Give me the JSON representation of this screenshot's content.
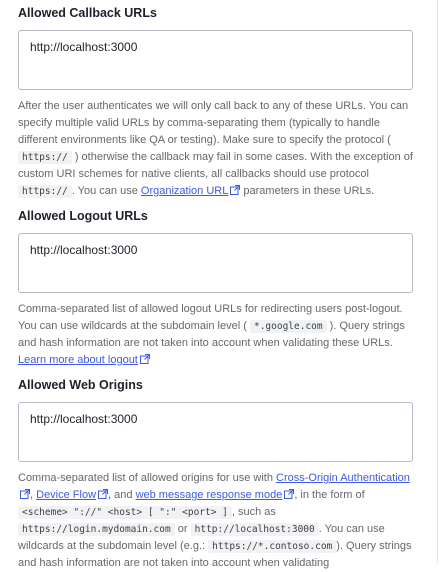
{
  "callback": {
    "label": "Allowed Callback URLs",
    "value": "http://localhost:3000",
    "help_1": "After the user authenticates we will only call back to any of these URLs. You can specify multiple valid URLs by comma-separating them (typically to handle different environments like QA or testing). Make sure to specify the protocol (",
    "code_1": "https://",
    "help_2": ") otherwise the callback may fail in some cases. With the exception of custom URI schemes for native clients, all callbacks should use protocol",
    "code_2": "https://",
    "help_3": ". You can use",
    "link": "Organization URL",
    "help_4": "parameters in these URLs."
  },
  "logout": {
    "label": "Allowed Logout URLs",
    "value": "http://localhost:3000",
    "help_1": "Comma-separated list of allowed logout URLs for redirecting users post-logout. You can use wildcards at the subdomain level (",
    "code_1": "*.google.com",
    "help_2": "). Query strings and hash information are not taken into account when validating these URLs.",
    "link": "Learn more about logout"
  },
  "web_origins": {
    "label": "Allowed Web Origins",
    "value": "http://localhost:3000",
    "help_1": "Comma-separated list of allowed origins for use with",
    "link_1": "Cross-Origin Authentication",
    "sep_1": ",",
    "link_2": "Device Flow",
    "sep_2": ", and",
    "link_3": "web message response mode",
    "help_2": ", in the form of",
    "code_1": "<scheme> \"://\" <host> [ \":\" <port> ]",
    "help_3": ", such as",
    "code_2": "https://login.mydomain.com",
    "help_4": "or",
    "code_3": "http://localhost:3000",
    "help_5": ". You can use wildcards at the subdomain level (e.g.:",
    "code_4": "https://*.contoso.com",
    "help_6": "). Query strings and hash information are not taken into account when validating"
  }
}
